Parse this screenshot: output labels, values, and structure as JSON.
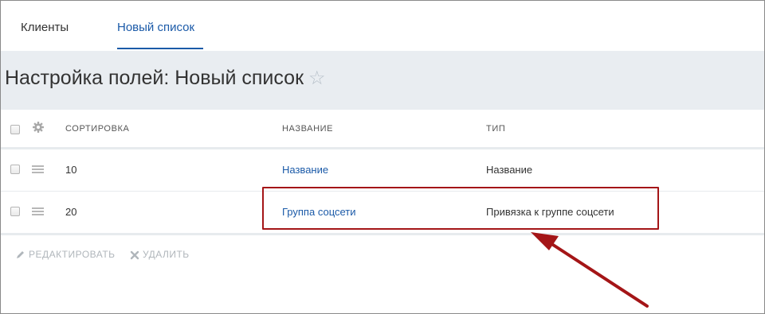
{
  "tabs": [
    {
      "label": "Клиенты",
      "active": false
    },
    {
      "label": "Новый список",
      "active": true
    }
  ],
  "page": {
    "title": "Настройка полей: Новый список",
    "star_icon": "star-outline-icon"
  },
  "table": {
    "headers": {
      "sort": "СОРТИРОВКА",
      "name": "НАЗВАНИЕ",
      "type": "ТИП"
    },
    "rows": [
      {
        "sort": "10",
        "name": "Название",
        "type": "Название"
      },
      {
        "sort": "20",
        "name": "Группа соцсети",
        "type": "Привязка к группе соцсети"
      }
    ]
  },
  "actions": {
    "edit": "РЕДАКТИРОВАТЬ",
    "delete": "УДАЛИТЬ"
  },
  "colors": {
    "accent": "#1b5aa8",
    "header_band": "#e9edf1",
    "annotation": "#a41517"
  }
}
